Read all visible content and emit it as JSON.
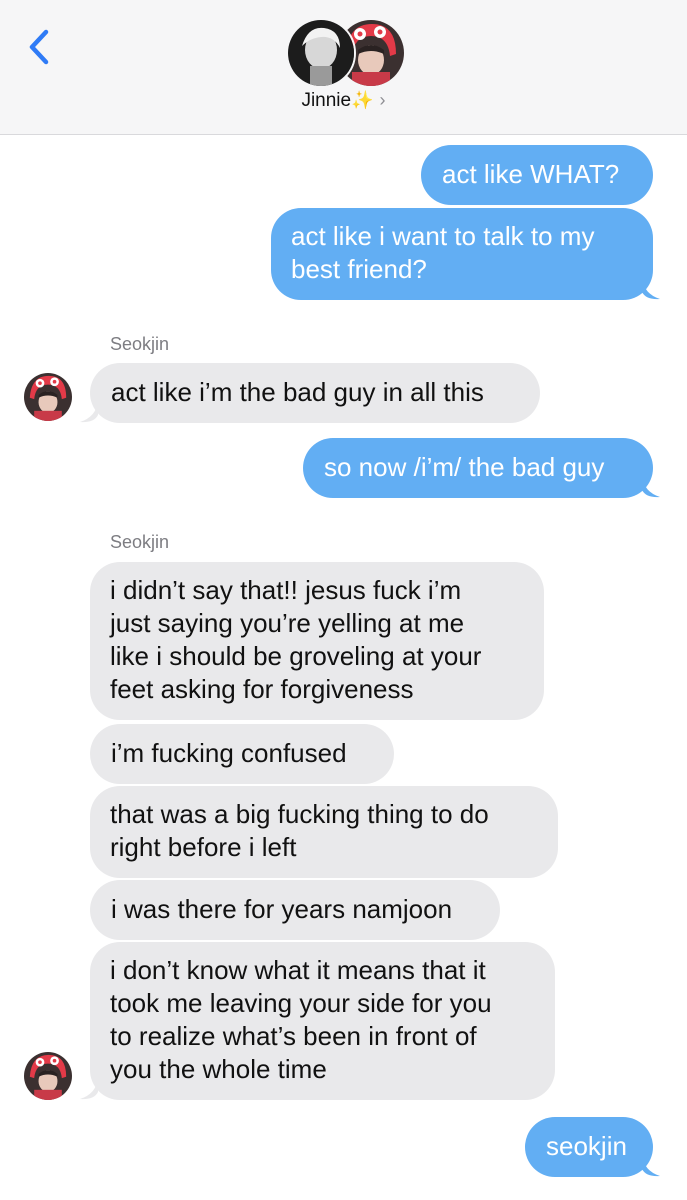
{
  "header": {
    "contact_name": "Jinnie",
    "sparkle": "✨",
    "chevron": "›",
    "back_icon": "chevron-left-icon"
  },
  "messages": {
    "m1": "act like WHAT?",
    "m2a": "act like i want to talk to my",
    "m2b": "best friend?",
    "sender1": "Seokjin",
    "m3": "act like i’m the bad guy in all this",
    "m4": "so now /i’m/ the bad guy",
    "sender2": "Seokjin",
    "m5a": "i didn’t say that!! jesus fuck i’m",
    "m5b": "just saying you’re yelling at me",
    "m5c": "like i should be groveling at your",
    "m5d": "feet asking for forgiveness",
    "m6": "i’m fucking confused",
    "m7a": "that was a big fucking thing to do",
    "m7b": "right before i left",
    "m8": "i was there for years namjoon",
    "m9a": "i don’t know what it means that it",
    "m9b": "took me leaving your side for you",
    "m9c": "to realize what’s been in front of",
    "m9d": "you the whole time",
    "m10": "seokjin"
  },
  "colors": {
    "outgoing_bubble": "#62aef3",
    "incoming_bubble": "#e9e9eb",
    "accent": "#2f7bf6"
  }
}
